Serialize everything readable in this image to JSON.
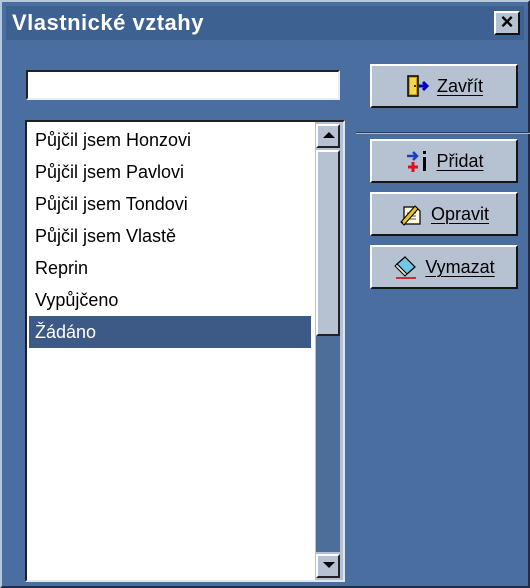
{
  "window": {
    "title": "Vlastnické vztahy",
    "close_glyph": "×"
  },
  "search": {
    "value": "",
    "placeholder": ""
  },
  "list": {
    "items": [
      "Půjčil jsem Honzovi",
      "Půjčil jsem Pavlovi",
      "Půjčil jsem Tondovi",
      "Půjčil jsem Vlastě",
      "Reprin",
      "Vypůjčeno",
      "Žádáno"
    ],
    "selected_index": 6
  },
  "buttons": {
    "close": {
      "label": "Zavřít",
      "icon": "exit-door-icon"
    },
    "add": {
      "label": "Přidat",
      "icon": "add-icon"
    },
    "edit": {
      "label": "Opravit",
      "icon": "edit-document-icon"
    },
    "delete": {
      "label": "Vymazat",
      "icon": "eraser-icon"
    }
  },
  "colors": {
    "window_bg": "#4a6ea0",
    "selection": "#3d5a86",
    "button_face": "#b6c2d2"
  }
}
